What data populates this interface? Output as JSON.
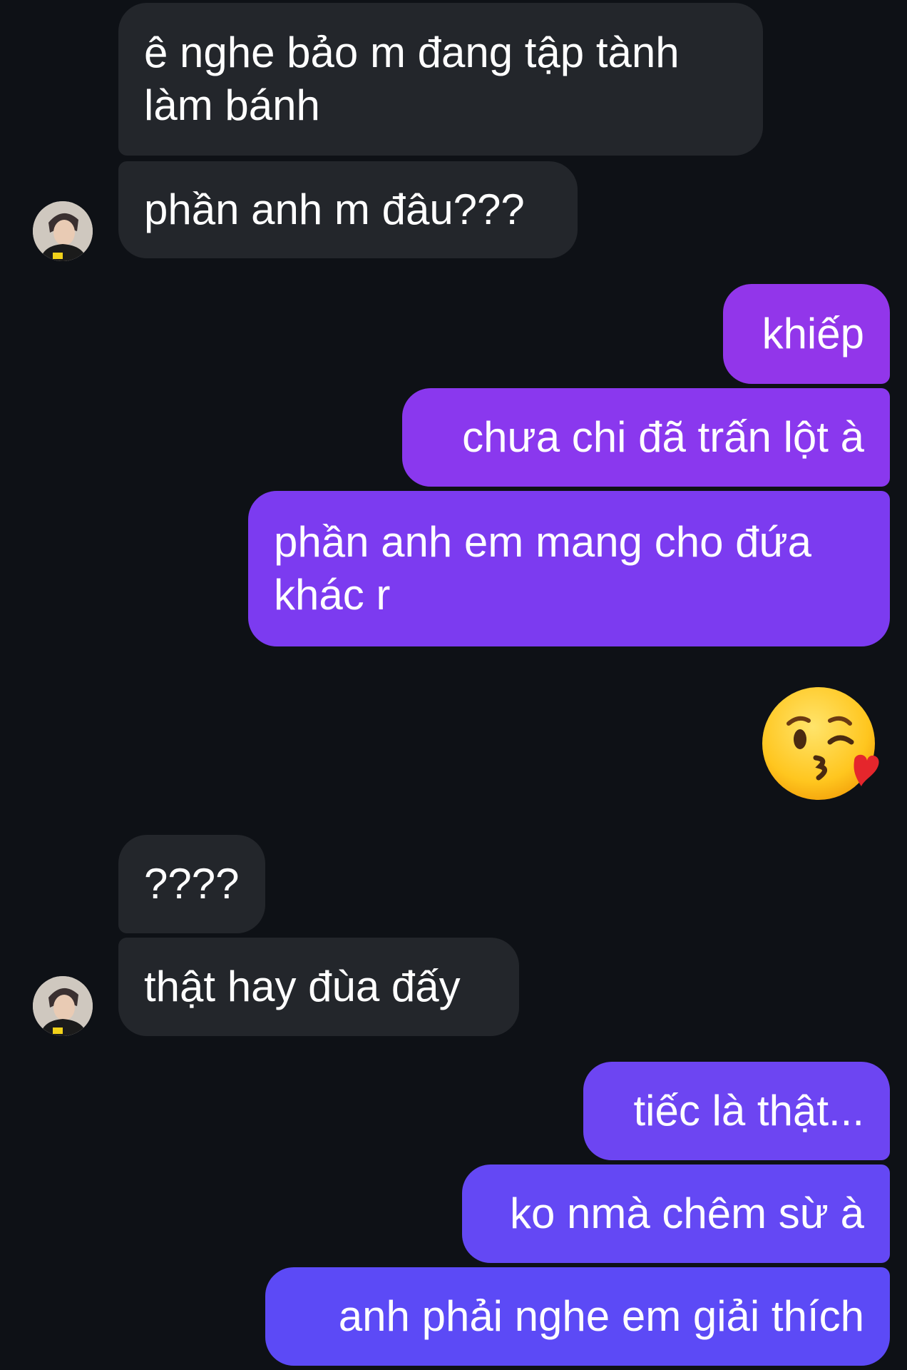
{
  "conversation": {
    "messages": [
      {
        "from": "them",
        "text": "ê nghe bảo m đang tập tành làm bánh"
      },
      {
        "from": "them",
        "text": "phần anh m đâu???"
      },
      {
        "from": "me",
        "text": "khiếp"
      },
      {
        "from": "me",
        "text": "chưa chi đã trấn lột à"
      },
      {
        "from": "me",
        "text": "phần anh em mang cho đứa khác r"
      },
      {
        "from": "me",
        "emoji": "face-blowing-a-kiss"
      },
      {
        "from": "them",
        "text": "????"
      },
      {
        "from": "them",
        "text": "thật hay đùa đấy"
      },
      {
        "from": "me",
        "text": "tiếc là thật..."
      },
      {
        "from": "me",
        "text": "ko nmà chêm sừ à"
      },
      {
        "from": "me",
        "text": "anh phải nghe em giải thích"
      }
    ]
  },
  "colors": {
    "background": "#0e1116",
    "incoming_bubble": "#23262b",
    "outgoing_gradient_top": "#9333ea",
    "outgoing_gradient_bottom": "#5a4af6"
  }
}
